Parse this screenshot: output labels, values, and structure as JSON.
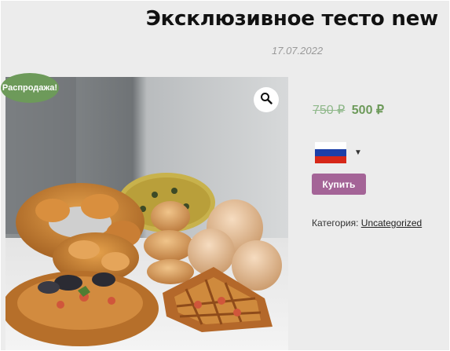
{
  "product": {
    "title": "Эксклюзивное тесто new",
    "date": "17.07.2022",
    "sale_badge": "Распродажа!",
    "price_old": "750 ₽",
    "price_new": "500 ₽",
    "currency_flag": "russia-flag",
    "buy_label": "Купить",
    "category_label": "Категория:",
    "category_value": "Uncategorized"
  },
  "icons": {
    "zoom": "magnifier-icon",
    "dropdown": "caret-down-icon"
  },
  "colors": {
    "sale_green": "#6d9a5a",
    "buy_purple": "#a46497",
    "background": "#ececec"
  }
}
